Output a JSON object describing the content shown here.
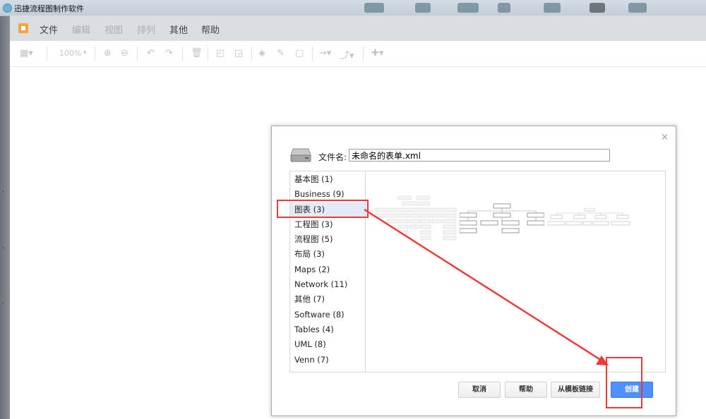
{
  "window": {
    "title": "迅捷流程图制作软件"
  },
  "menu": {
    "items": [
      {
        "label": "文件",
        "enabled": true
      },
      {
        "label": "编辑",
        "enabled": false
      },
      {
        "label": "视图",
        "enabled": false
      },
      {
        "label": "排列",
        "enabled": false
      },
      {
        "label": "其他",
        "enabled": true
      },
      {
        "label": "帮助",
        "enabled": true
      }
    ]
  },
  "toolbar": {
    "zoom": "100%"
  },
  "dialog": {
    "close_glyph": "×",
    "filename_label": "文件名:",
    "filename_value": "未命名的表单.xml",
    "categories": [
      {
        "label": "基本图 (1)"
      },
      {
        "label": "Business (9)"
      },
      {
        "label": "图表 (3)",
        "selected": true
      },
      {
        "label": "工程图 (3)"
      },
      {
        "label": "流程图 (5)"
      },
      {
        "label": "布局 (3)"
      },
      {
        "label": "Maps (2)"
      },
      {
        "label": "Network (11)"
      },
      {
        "label": "其他 (7)"
      },
      {
        "label": "Software (8)"
      },
      {
        "label": "Tables (4)"
      },
      {
        "label": "UML (8)"
      },
      {
        "label": "Venn (7)"
      }
    ],
    "buttons": {
      "cancel": "取消",
      "help": "帮助",
      "from_template_link": "从模板链接",
      "create": "创建"
    }
  },
  "colors": {
    "annotation_red": "#ee3a36",
    "primary_blue": "#4d90fe",
    "selected_row": "#e4ebf7"
  }
}
